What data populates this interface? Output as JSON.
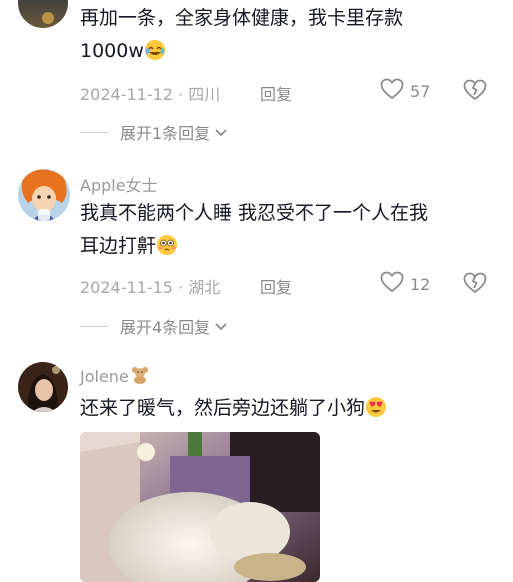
{
  "comments": [
    {
      "text": "再加一条，全家身体健康，我卡里存款1000w",
      "text_line1": "再加一条，全家身体健康，我卡里存款",
      "text_line2": "1000w",
      "emoji": "laughing-tears-emoji",
      "date_location": "2024-11-12 · 四川",
      "reply_label": "回复",
      "likes": "57",
      "expand_label": "展开1条回复"
    },
    {
      "username": "Apple女士",
      "text": "我真不能两个人睡 我忍受不了一个人在我耳边打鼾",
      "text_line1": "我真不能两个人睡 我忍受不了一个人在我",
      "text_line2": "耳边打鼾",
      "emoji": "flushed-face-emoji",
      "date_location": "2024-11-15 · 湖北",
      "reply_label": "回复",
      "likes": "12",
      "expand_label": "展开4条回复"
    },
    {
      "username": "Jolene",
      "username_badge": "teddy-bear-emoji",
      "text": "还来了暖气，然后旁边还躺了小狗",
      "emoji": "heart-eyes-emoji",
      "image": "photo-of-dog-in-bed"
    }
  ],
  "icons": {
    "like": "heart-outline-icon",
    "dislike": "broken-heart-outline-icon",
    "expand": "chevron-down-icon"
  },
  "colors": {
    "text": "#161823",
    "secondary": "#a7a7ab",
    "background": "#ffffff"
  }
}
